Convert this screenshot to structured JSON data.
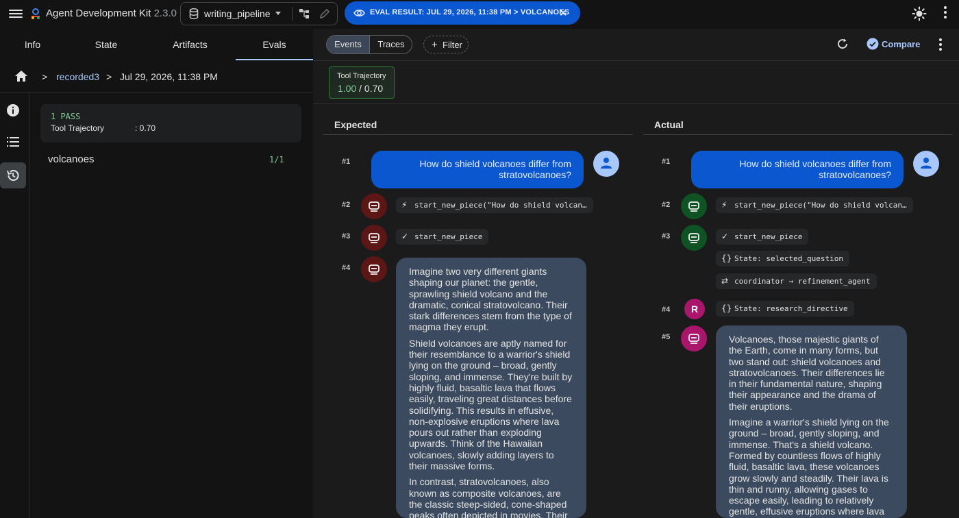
{
  "header": {
    "app_name": "Agent Development Kit",
    "version": "2.3.0",
    "app_select_value": "writing_pipeline",
    "eval_chip": "EVAL RESULT: JUL 29, 2026, 11:38 PM > VOLCANOES"
  },
  "left": {
    "tabs": [
      "Info",
      "State",
      "Artifacts",
      "Evals"
    ],
    "active_tab": "Evals",
    "breadcrumb": {
      "sep": ">",
      "link": "recorded3",
      "date": "Jul 29, 2026, 11:38 PM"
    },
    "summary": {
      "pass": "1 PASS",
      "metric_name": "Tool Trajectory",
      "metric_value": ": 0.70"
    },
    "case": {
      "name": "volcanoes",
      "count": "1/1"
    }
  },
  "toolbar": {
    "events": "Events",
    "traces": "Traces",
    "filter": "Filter",
    "compare": "Compare"
  },
  "trajectory": {
    "label": "Tool Trajectory",
    "score": "1.00",
    "threshold": "/ 0.70"
  },
  "expected": {
    "heading": "Expected",
    "items": [
      {
        "idx": "#1",
        "text": "How do shield volcanoes differ from stratovolcanoes?"
      },
      {
        "idx": "#2",
        "chip": "start_new_piece(\"How do shield volcan…"
      },
      {
        "idx": "#3",
        "chip": "start_new_piece"
      },
      {
        "idx": "#4",
        "paragraphs": [
          "Imagine two very different giants shaping our planet: the gentle, sprawling shield volcano and the dramatic, conical stratovolcano. Their stark differences stem from the type of magma they erupt.",
          "Shield volcanoes are aptly named for their resemblance to a warrior's shield lying on the ground – broad, gently sloping, and immense. They're built by highly fluid, basaltic lava that flows easily, traveling great distances before solidifying. This results in effusive, non-explosive eruptions where lava pours out rather than exploding upwards. Think of the Hawaiian volcanoes, slowly adding layers to their massive forms.",
          "In contrast, stratovolcanoes, also known as composite volcanoes, are the classic steep-sided, cone-shaped peaks often depicted in movies. Their formation is a layered process of alternating"
        ]
      }
    ]
  },
  "actual": {
    "heading": "Actual",
    "items": [
      {
        "idx": "#1",
        "text": "How do shield volcanoes differ from stratovolcanoes?"
      },
      {
        "idx": "#2",
        "chip": "start_new_piece(\"How do shield volcan…"
      },
      {
        "idx": "#3",
        "chips": [
          "start_new_piece",
          "State: selected_question",
          "coordinator → refinement_agent"
        ]
      },
      {
        "idx": "#4",
        "avatar": "R",
        "chip": "State: research_directive"
      },
      {
        "idx": "#5",
        "paragraphs": [
          "Volcanoes, those majestic giants of the Earth, come in many forms, but two stand out: shield volcanoes and stratovolcanoes. Their differences lie in their fundamental nature, shaping their appearance and the drama of their eruptions.",
          "Imagine a warrior's shield lying on the ground – broad, gently sloping, and immense. That's a shield volcano. Formed by countless flows of highly fluid, basaltic lava, these volcanoes grow slowly and steadily. Their lava is thin and runny, allowing gases to escape easily, leading to relatively gentle, effusive eruptions where lava"
        ]
      }
    ]
  },
  "colors": {
    "accent": "#0b57d0",
    "pass": "#81c995",
    "link": "#a8c7fa",
    "bot_expected": "#5c1616",
    "bot_actual": "#0f5223",
    "bot_pink": "#a9166b",
    "response_bg": "#3b4a5e"
  },
  "icons": [
    "menu-icon",
    "adk-logo-icon",
    "database-icon",
    "graph-icon",
    "pencil-icon",
    "eye-icon",
    "close-icon",
    "sun-icon",
    "more-vert-icon",
    "home-icon",
    "info-icon",
    "list-icon",
    "history-icon",
    "refresh-icon",
    "check-circle-icon",
    "plus-icon",
    "person-icon",
    "robot-icon",
    "bolt-icon",
    "check-icon",
    "braces-icon",
    "transfer-icon"
  ]
}
